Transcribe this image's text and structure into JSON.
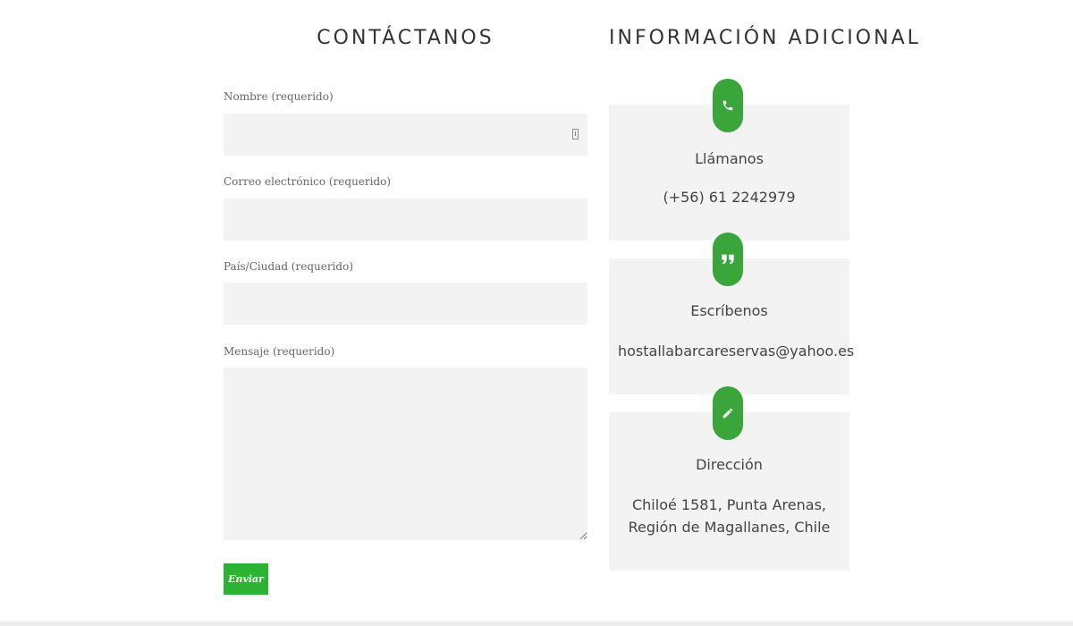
{
  "contact": {
    "title": "CONTÁCTANOS",
    "fields": {
      "name": {
        "label": "Nombre (requerido)",
        "value": ""
      },
      "email": {
        "label": "Correo electrónico (requerido)",
        "value": ""
      },
      "location": {
        "label": "País/Ciudad (requerido)",
        "value": ""
      },
      "message": {
        "label": "Mensaje (requerido)",
        "value": ""
      }
    },
    "submit_label": "Enviar"
  },
  "info": {
    "title": "INFORMACIÓN ADICIONAL",
    "cards": [
      {
        "icon": "phone-icon",
        "title": "Llámanos",
        "value": "(+56) 61 2242979"
      },
      {
        "icon": "quote-icon",
        "title": "Escríbenos",
        "value": "hostallabarcareservas@yahoo.es"
      },
      {
        "icon": "pencil-icon",
        "title": "Dirección",
        "value": "Chiloé 1581, Punta Arenas, Región de Magallanes, Chile"
      }
    ]
  },
  "colors": {
    "accent": "#2cb333",
    "icon_bg": "#3aa53a",
    "field_bg": "#f3f3f3",
    "card_bg": "#f3f3f3"
  }
}
